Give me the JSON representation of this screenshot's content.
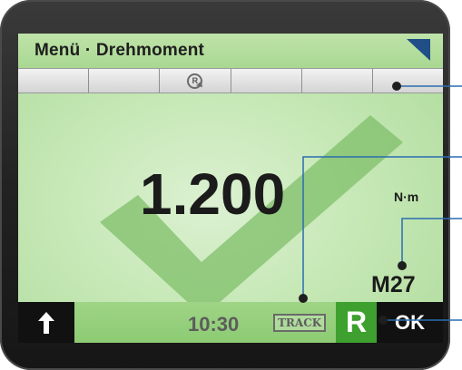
{
  "header": {
    "title": "Menü · Drehmoment",
    "flag_icon": "triangle-flag-icon"
  },
  "softkeys": {
    "count": 6,
    "reset_icon": "reset-r-icon",
    "reset_icon_label": "R"
  },
  "reading": {
    "value": "1.200",
    "unit": "N·m",
    "size": "M27",
    "status_icon": "checkmark-icon"
  },
  "footer": {
    "up_icon": "arrow-up-icon",
    "time": "10:30",
    "track_label": "TRACK",
    "r_label": "R",
    "ok_label": "OK"
  },
  "colors": {
    "screen_green": "#c6e8b6",
    "header_green": "#a9d892",
    "bar_green": "#8ccb73",
    "check_green": "#7fbf6a",
    "r_button_green": "#3ea02f",
    "flag_blue": "#1f4f86",
    "leader_blue": "#2a6db0"
  }
}
